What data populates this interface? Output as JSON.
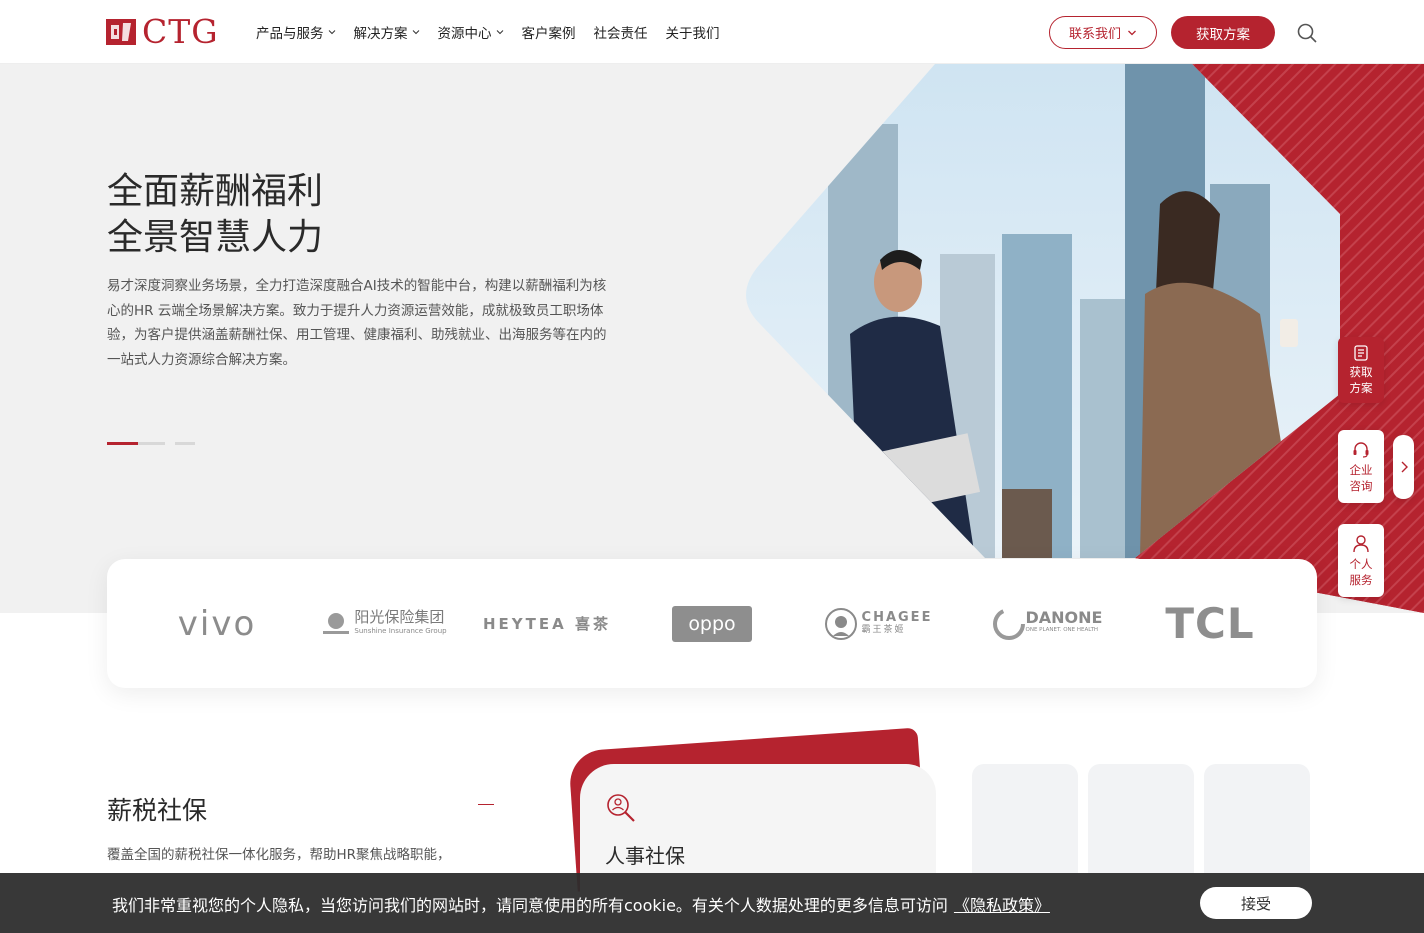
{
  "brand": {
    "name": "CTG"
  },
  "nav": {
    "items": [
      {
        "label": "产品与服务",
        "dropdown": true
      },
      {
        "label": "解决方案",
        "dropdown": true
      },
      {
        "label": "资源中心",
        "dropdown": true
      },
      {
        "label": "客户案例",
        "dropdown": false
      },
      {
        "label": "社会责任",
        "dropdown": false
      },
      {
        "label": "关于我们",
        "dropdown": false
      }
    ],
    "contact_label": "联系我们",
    "cta_label": "获取方案"
  },
  "hero": {
    "title_line1": "全面薪酬福利",
    "title_line2": "全景智慧人力",
    "description": "易才深度洞察业务场景，全力打造深度融合AI技术的智能中台，构建以薪酬福利为核心的HR 云端全场景解决方案。致力于提升人力资源运营效能，成就极致员工职场体验，为客户提供涵盖薪酬社保、用工管理、健康福利、助残就业、出海服务等在内的一站式人力资源综合解决方案。",
    "slides": 3,
    "active_slide": 1
  },
  "side": {
    "get_plan": "获取方案",
    "consult": "企业咨询",
    "personal": "个人服务"
  },
  "logos": [
    "vivo",
    "阳光保险集团",
    "HEYTEA 喜茶",
    "oppo",
    "CHAGEE 霸王茶姬",
    "DANONE",
    "TCL"
  ],
  "logo_subs": {
    "sunshine": "Sunshine Insurance Group",
    "danone": "ONE PLANET. ONE HEALTH",
    "chagee": "霸王茶姬"
  },
  "section": {
    "title": "薪税社保",
    "description": "覆盖全国的薪税社保一体化服务，帮助HR聚焦战略职能，",
    "card_title": "人事社保"
  },
  "cookie": {
    "text": "我们非常重视您的个人隐私，当您访问我们的网站时，请同意使用的所有cookie。有关个人数据处理的更多信息可访问",
    "link": "《隐私政策》",
    "accept": "接受"
  },
  "colors": {
    "accent": "#b5232f",
    "hero_bg": "#f1f1f1"
  }
}
